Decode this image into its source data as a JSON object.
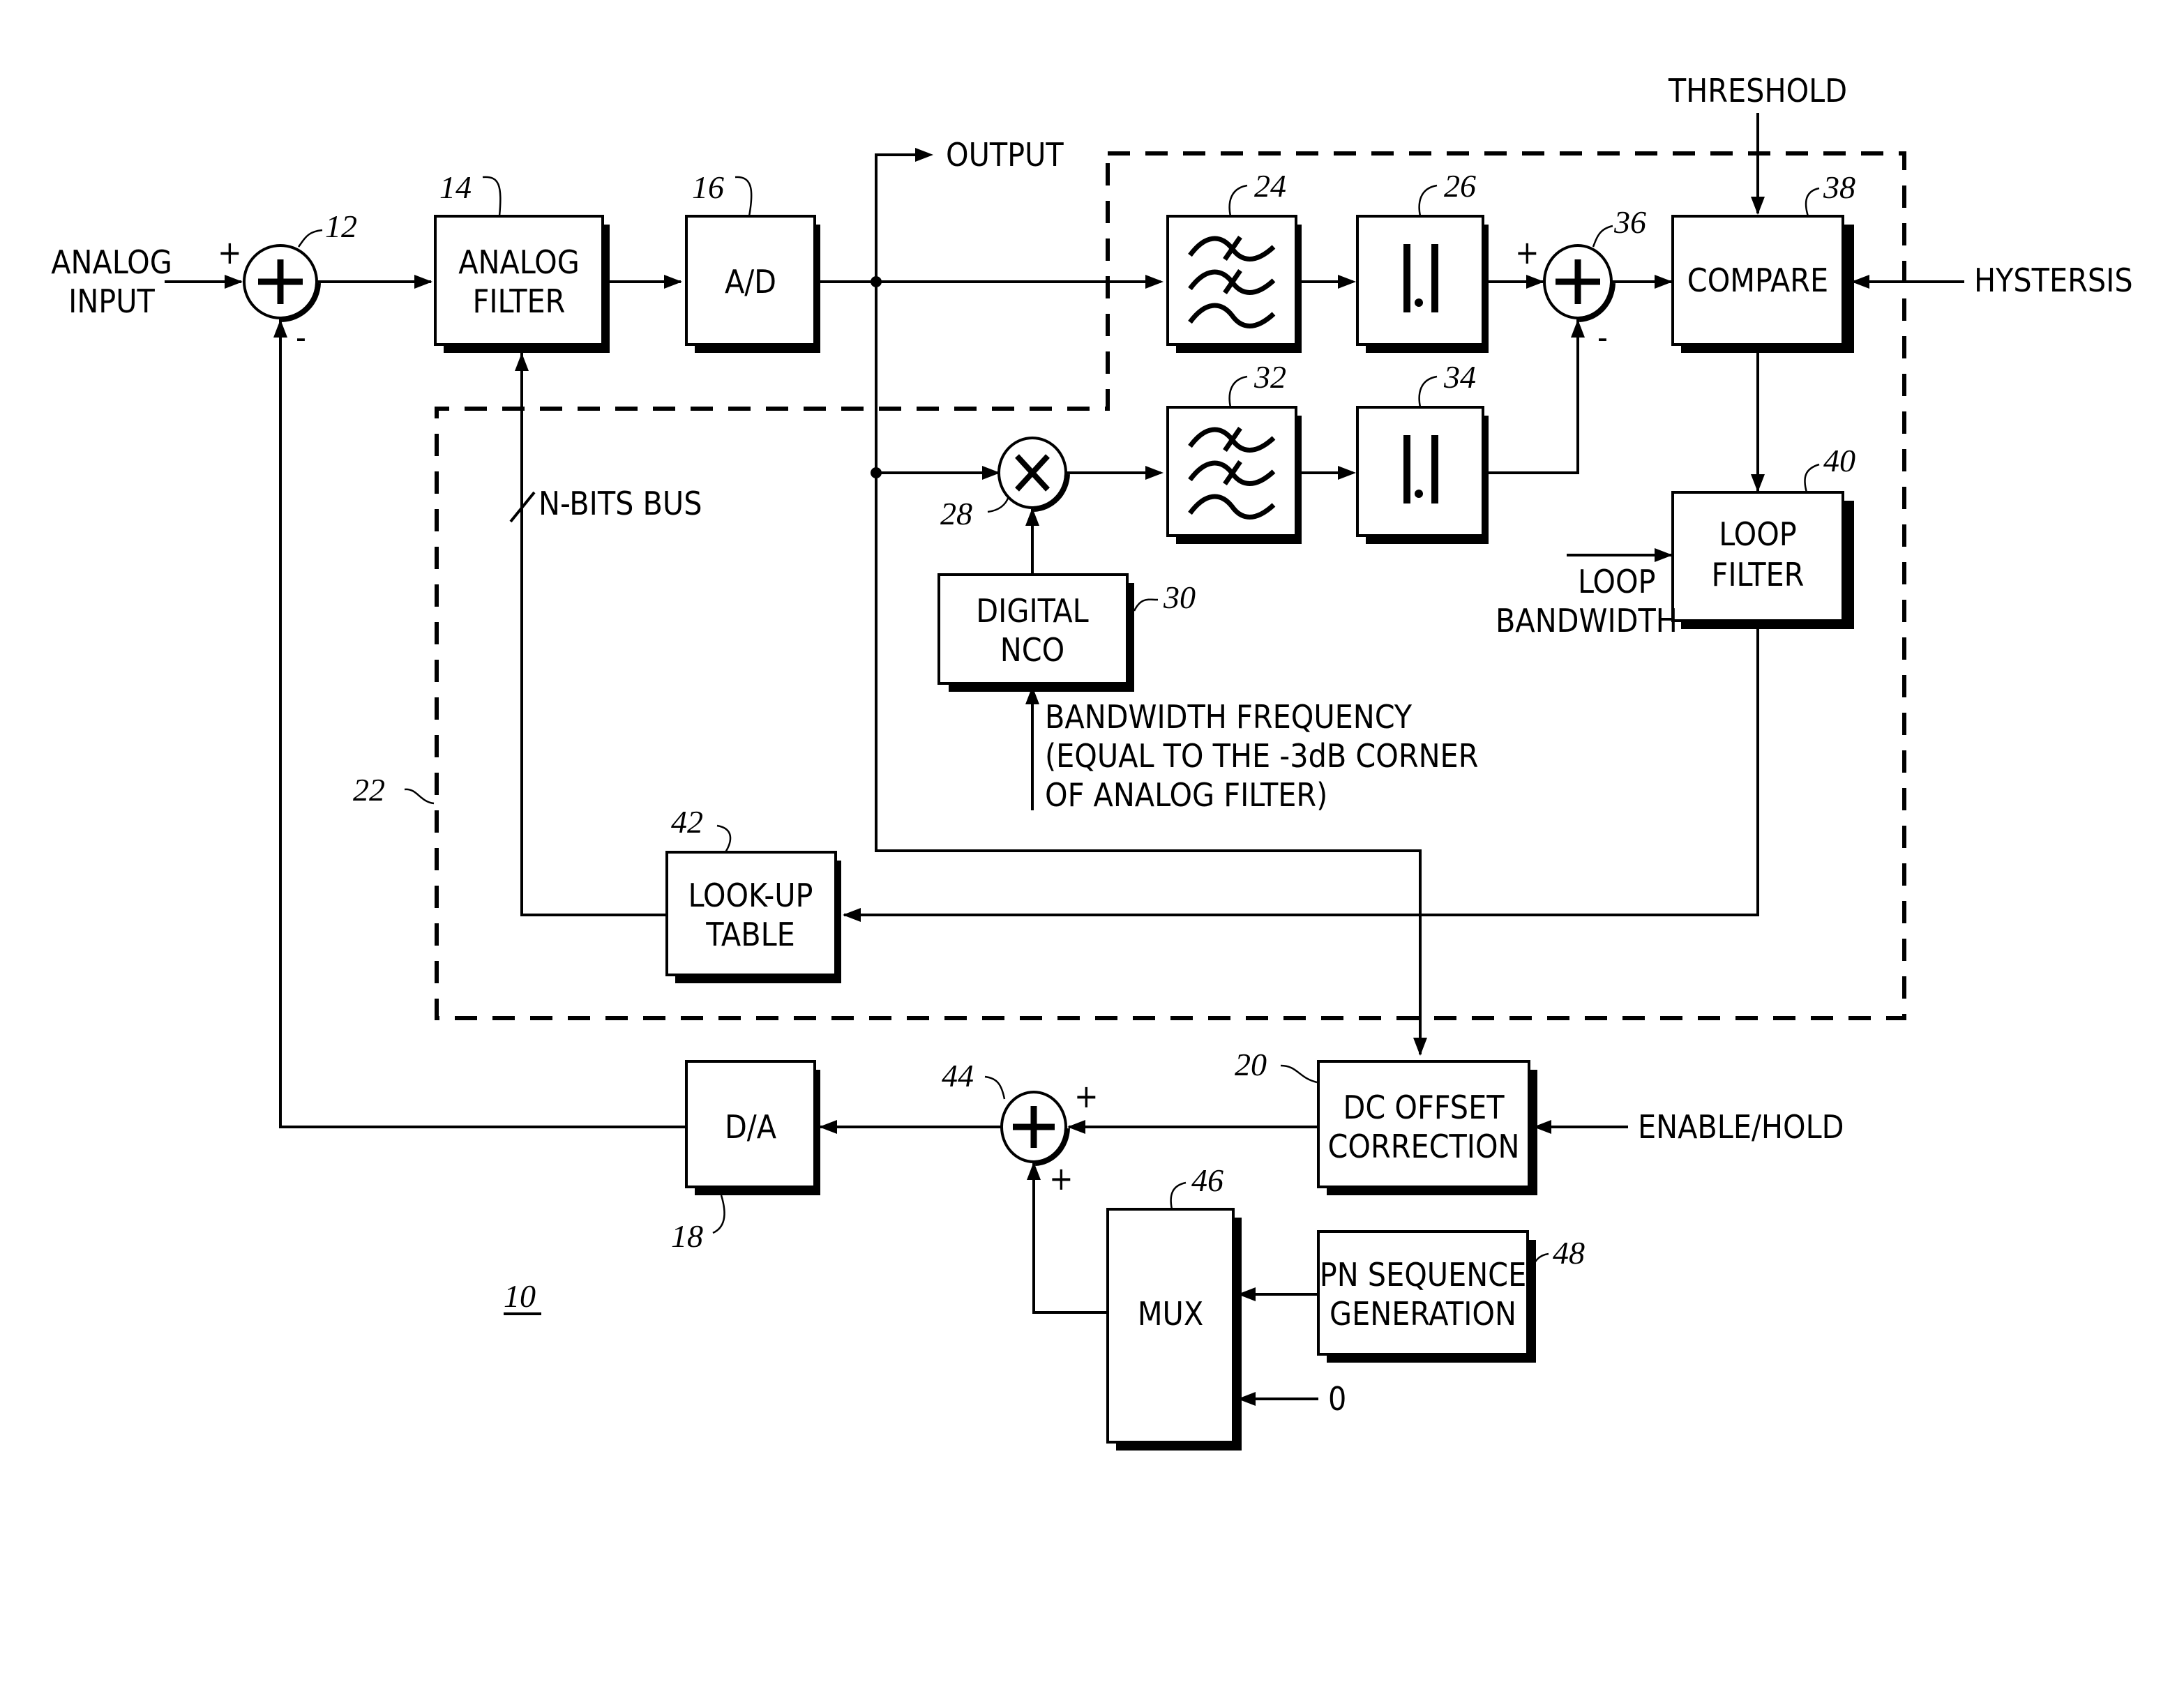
{
  "figure": {
    "number_label": "10",
    "inputs": {
      "analog_input": [
        "ANALOG",
        "INPUT"
      ],
      "threshold": "THRESHOLD",
      "hystersis": "HYSTERSIS",
      "loop_bandwidth": [
        "LOOP",
        "BANDWIDTH"
      ],
      "bandwidth_frequency": [
        "BANDWIDTH FREQUENCY",
        "(EQUAL TO THE -3dB CORNER",
        "OF ANALOG FILTER)"
      ],
      "enable_hold": "ENABLE/HOLD",
      "zero": "0"
    },
    "outputs": {
      "output": "OUTPUT"
    },
    "bus_label": "N-BITS BUS",
    "blocks": {
      "analog_filter": {
        "ref": "14",
        "lines": [
          "ANALOG",
          "FILTER"
        ]
      },
      "ad": {
        "ref": "16",
        "lines": [
          "A/D"
        ]
      },
      "da": {
        "ref": "18",
        "lines": [
          "D/A"
        ]
      },
      "dc_offset": {
        "ref": "20",
        "lines": [
          "DC OFFSET",
          "CORRECTION"
        ]
      },
      "bpf_top": {
        "ref": "24",
        "icon": "bandpass-filter-icon"
      },
      "abs_top": {
        "ref": "26",
        "icon": "absolute-value-icon"
      },
      "nco": {
        "ref": "30",
        "lines": [
          "DIGITAL",
          "NCO"
        ]
      },
      "bpf_bottom": {
        "ref": "32",
        "icon": "bandpass-filter-icon"
      },
      "abs_bottom": {
        "ref": "34",
        "icon": "absolute-value-icon"
      },
      "compare": {
        "ref": "38",
        "lines": [
          "COMPARE"
        ]
      },
      "loop_filter": {
        "ref": "40",
        "lines": [
          "LOOP",
          "FILTER"
        ]
      },
      "lut": {
        "ref": "42",
        "lines": [
          "LOOK-UP",
          "TABLE"
        ]
      },
      "mux": {
        "ref": "46",
        "lines": [
          "MUX"
        ]
      },
      "pn": {
        "ref": "48",
        "lines": [
          "PN SEQUENCE",
          "GENERATION"
        ]
      }
    },
    "junctions": {
      "sum_input": {
        "ref": "12",
        "plus": "+",
        "minus": "-"
      },
      "mixer": {
        "ref": "28"
      },
      "sum_compare": {
        "ref": "36",
        "plus": "+",
        "minus": "-"
      },
      "sum_dither": {
        "ref": "44",
        "plus_a": "+",
        "plus_b": "+"
      }
    },
    "calibration_block": {
      "ref": "22"
    }
  }
}
